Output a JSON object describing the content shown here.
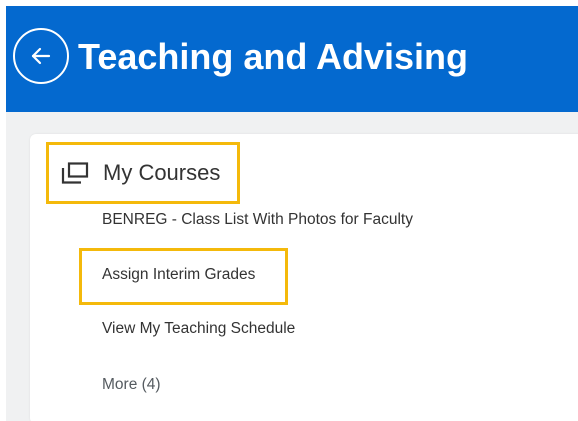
{
  "header": {
    "title": "Teaching and Advising",
    "back_icon": "back-arrow-icon",
    "background_color": "#0469cf"
  },
  "card": {
    "title": "My Courses",
    "icon": "windows-stack-icon",
    "highlight_color": "#f4b90b",
    "links": [
      {
        "label": "BENREG - Class List With Photos for Faculty"
      },
      {
        "label": "Assign Interim Grades",
        "highlighted": true
      },
      {
        "label": "View My Teaching Schedule"
      }
    ],
    "more_label": "More (4)"
  }
}
